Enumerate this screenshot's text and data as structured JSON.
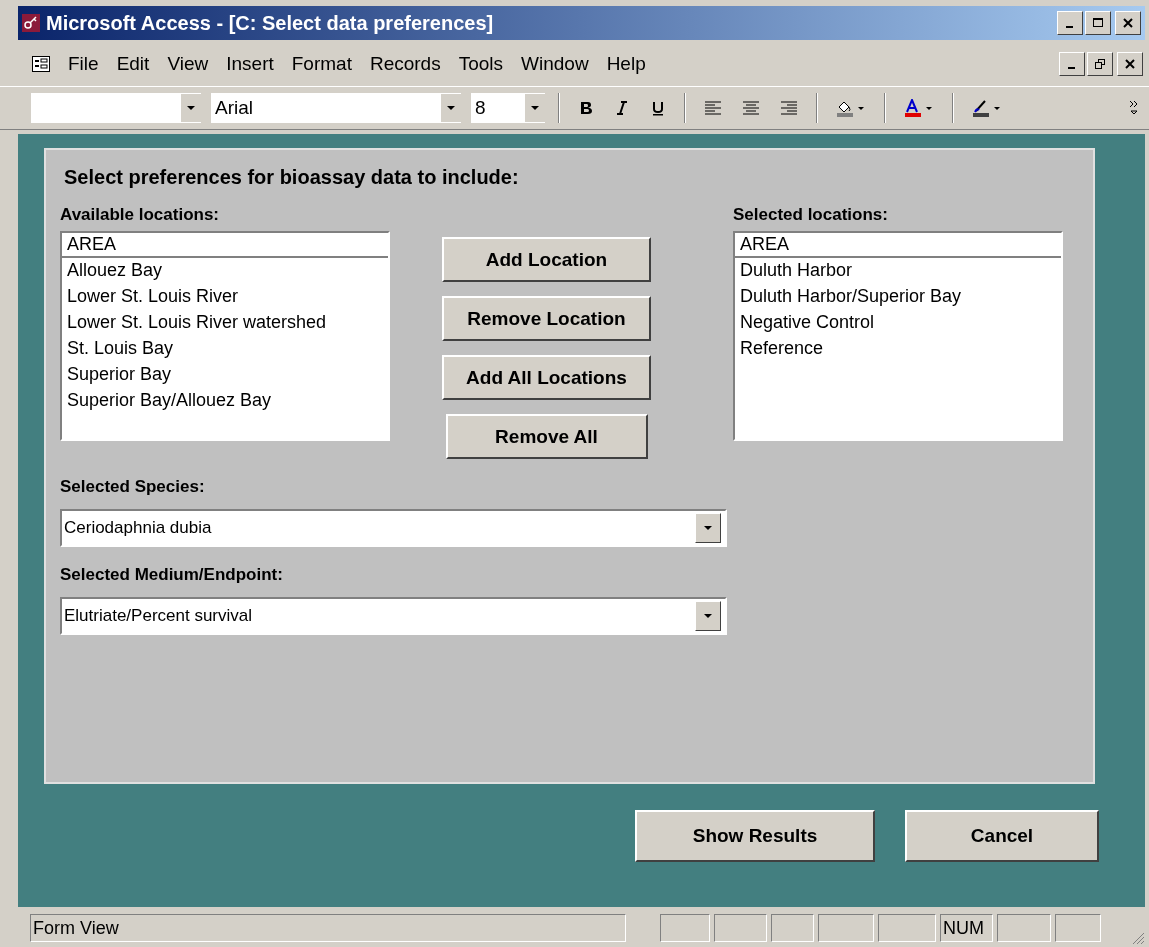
{
  "window": {
    "title": "Microsoft Access - [C: Select data preferences]"
  },
  "menu": [
    {
      "label": "File"
    },
    {
      "label": "Edit"
    },
    {
      "label": "View"
    },
    {
      "label": "Insert"
    },
    {
      "label": "Format"
    },
    {
      "label": "Records"
    },
    {
      "label": "Tools"
    },
    {
      "label": "Window"
    },
    {
      "label": "Help"
    }
  ],
  "toolbar": {
    "font": "Arial",
    "size": "8"
  },
  "form": {
    "heading": "Select preferences for bioassay data to include:",
    "available": {
      "label": "Available locations:",
      "header": "AREA",
      "items": [
        "Allouez Bay",
        "Lower St. Louis River",
        "Lower St. Louis River watershed",
        "St. Louis Bay",
        "Superior Bay",
        "Superior Bay/Allouez Bay"
      ]
    },
    "buttons": [
      "Add Location",
      "Remove Location",
      "Add All Locations",
      "Remove All"
    ],
    "selected": {
      "label": "Selected locations:",
      "header": "AREA",
      "items": [
        "Duluth Harbor",
        "Duluth Harbor/Superior Bay",
        "Negative Control",
        "Reference"
      ]
    },
    "species": {
      "label": "Selected Species:",
      "value": "Ceriodaphnia dubia"
    },
    "medium": {
      "label": "Selected Medium/Endpoint:",
      "value": "Elutriate/Percent survival"
    }
  },
  "actions": [
    "Show Results",
    "Cancel"
  ],
  "status_bar": {
    "text": "Form View",
    "indicators": [
      "NUM"
    ]
  }
}
